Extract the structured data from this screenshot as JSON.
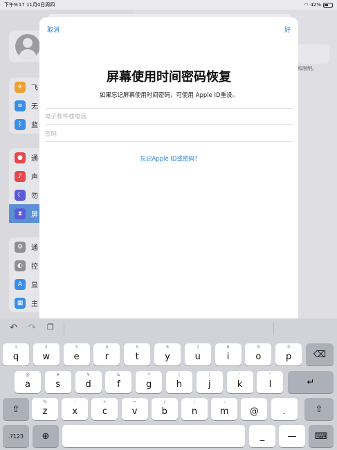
{
  "status_bar": {
    "time_date": "下午9:17  11月4日周四",
    "battery": "42%"
  },
  "background": {
    "sidebar_groups": [
      [
        {
          "label": "飞",
          "icon": "airplane-icon",
          "color": "#f0a030"
        },
        {
          "label": "无",
          "icon": "wifi-icon",
          "color": "#3a8ee6"
        },
        {
          "label": "蓝",
          "icon": "bluetooth-icon",
          "color": "#3a8ee6"
        }
      ],
      [
        {
          "label": "通",
          "icon": "notification-icon",
          "color": "#e5484d"
        },
        {
          "label": "声",
          "icon": "sound-icon",
          "color": "#e5484d"
        },
        {
          "label": "勿",
          "icon": "moon-icon",
          "color": "#5b5bd6"
        },
        {
          "label": "屏",
          "icon": "hourglass-icon",
          "color": "#5b5bd6"
        }
      ],
      [
        {
          "label": "通",
          "icon": "gear-icon",
          "color": "#8e8e93"
        },
        {
          "label": "控",
          "icon": "toggles-icon",
          "color": "#8e8e93"
        },
        {
          "label": "显",
          "icon": "display-icon",
          "color": "#3a8ee6"
        },
        {
          "label": "主",
          "icon": "home-grid-icon",
          "color": "#3a8ee6"
        }
      ]
    ],
    "right_text": "和限制。"
  },
  "modal": {
    "cancel_label": "取消",
    "ok_label": "好",
    "title": "屏幕使用时间密码恢复",
    "subtitle": "如果忘记屏幕使用时间密码，可使用 Apple ID重设。",
    "email_placeholder": "电子邮件或电话",
    "password_placeholder": "密码",
    "forgot_link": "忘记Apple ID或密码?"
  },
  "keyboard": {
    "row1": [
      {
        "hint": "1",
        "key": "q"
      },
      {
        "hint": "2",
        "key": "w"
      },
      {
        "hint": "3",
        "key": "e"
      },
      {
        "hint": "4",
        "key": "r"
      },
      {
        "hint": "5",
        "key": "t"
      },
      {
        "hint": "6",
        "key": "y"
      },
      {
        "hint": "7",
        "key": "u"
      },
      {
        "hint": "8",
        "key": "i"
      },
      {
        "hint": "9",
        "key": "o"
      },
      {
        "hint": "0",
        "key": "p"
      }
    ],
    "row2": [
      {
        "hint": "@",
        "key": "a"
      },
      {
        "hint": "#",
        "key": "s"
      },
      {
        "hint": "¥",
        "key": "d"
      },
      {
        "hint": "&",
        "key": "f"
      },
      {
        "hint": "*",
        "key": "g"
      },
      {
        "hint": "(",
        "key": "h"
      },
      {
        "hint": ")",
        "key": "j"
      },
      {
        "hint": "'",
        "key": "k"
      },
      {
        "hint": "\"",
        "key": "l"
      }
    ],
    "row3": [
      {
        "hint": "%",
        "key": "z"
      },
      {
        "hint": "-",
        "key": "x"
      },
      {
        "hint": "+",
        "key": "c"
      },
      {
        "hint": "=",
        "key": "v"
      },
      {
        "hint": "/",
        "key": "b"
      },
      {
        "hint": ";",
        "key": "n"
      },
      {
        "hint": ":",
        "key": "m"
      },
      {
        "hint": "",
        "key": "@"
      },
      {
        "hint": "",
        "key": "."
      }
    ],
    "num_key": ".?123",
    "underscore": "_",
    "dash": "—"
  }
}
